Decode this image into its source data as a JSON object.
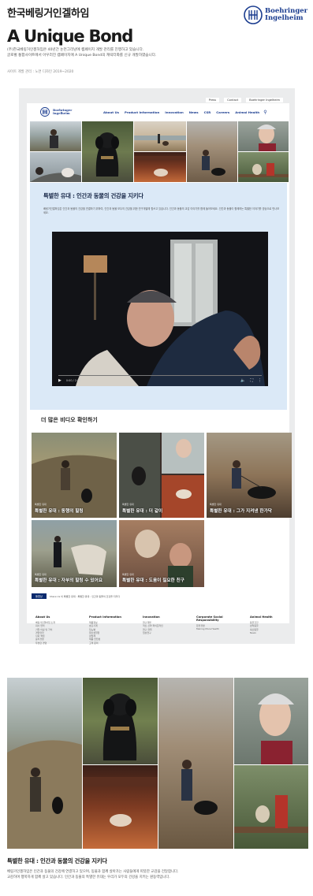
{
  "header": {
    "brand_kr": "한국베링거인겔하임",
    "title": "A Unique Bond",
    "logo_line1": "Boehringer",
    "logo_line2": "Ingelheim",
    "desc_line1": "(주)한국베링거인겔하임은 40년간 눈먼그리냥에 캠페이지 개발 관리를 진행하고 있습니다.",
    "desc_line2": "글로벌 통합사이트에서 아우러진 캠페이지에 A Unique Bond의 캐릭터화를 신규 개발하였습니다.",
    "meta": "사이트 개발 관리 : 노면 디자인 2019~2020"
  },
  "site": {
    "top_links": [
      "Press",
      "Contact",
      "Boehringer Ingelheim"
    ],
    "logo_line1": "Boehringer",
    "logo_line2": "Ingelheim",
    "nav": [
      "About Us",
      "Product Information",
      "Innovation",
      "News",
      "CSR",
      "Careers",
      "Animal Health"
    ],
    "banner_title": "특별한 유대 : 인간과 동물의 건강을 지키다",
    "banner_text": "베링거인겔하임은 인간과 동물의 건강을 연결하기 위하여, 인간과 동물 모두의 건강을 위한 연구개발에 힘쓰고 있습니다. 인간과 동물의 교감 이야기를 함께 들어보세요. 인간과 동물이 함께하는 특별한 이야기를 영상으로 만나보세요.",
    "more_title": "더 많은 비디오 확인하기",
    "cards": [
      {
        "label": "특별한 유대 : 동행의 힐링",
        "sub": "특별한 유대"
      },
      {
        "label": "특별한 유대 : 더 같이",
        "sub": "특별한 유대"
      },
      {
        "label": "특별한 유대 : 그가 지켜낸 한가닥",
        "sub": "특별한 유대"
      },
      {
        "label": "특별한 유대 : 자부의 힐링 수 있어요",
        "sub": "특별한 유대"
      },
      {
        "label": "특별한 유대 : 도움이 필요한 친구",
        "sub": "특별한 유대"
      }
    ],
    "tag": "동영상",
    "tag_info": "Share Us 이 특별한 유대 : 특별한 유대 : 인간과 동물의 건강을 지키다",
    "footer": [
      {
        "title": "About Us",
        "items": [
          "베링거인겔하임 소개",
          "회사 연혁",
          "기업 이념 및 가치",
          "경영철학",
          "사회 책임",
          "윤리경영",
          "투명한 경영"
        ]
      },
      {
        "title": "Product Information",
        "items": [
          "제품정보",
          "호흡기계",
          "당뇨병",
          "대사성질환",
          "항암제",
          "제품 안전성",
          "고객 문의"
        ]
      },
      {
        "title": "Innovation",
        "items": [
          "연구개발",
          "혁신 신약 파이프라인",
          "연구 협력",
          "임상연구"
        ]
      },
      {
        "title": "Corporate Social Responsibility",
        "items": [
          "환경경영",
          "Making More Health"
        ]
      },
      {
        "title": "Animal Health",
        "items": [
          "동물건강",
          "반려동물",
          "축산동물",
          "News"
        ]
      }
    ]
  },
  "bottom": {
    "title": "특별한 유대 : 인간과 동물의 건강을 지키다",
    "text_line1": "베링거인겔하임은 인간과 동물의 건강에 연결하고 있으며, 동물과 함께 살아가는 사람들에게 따뜻한 교감을 전달합니다.",
    "text_line2": "교감하며 행복하게 함께 살고 있습니다. 인간과 동물의 특별한 유대는 우리가 모두의 건강을 지키는 원동력입니다."
  }
}
